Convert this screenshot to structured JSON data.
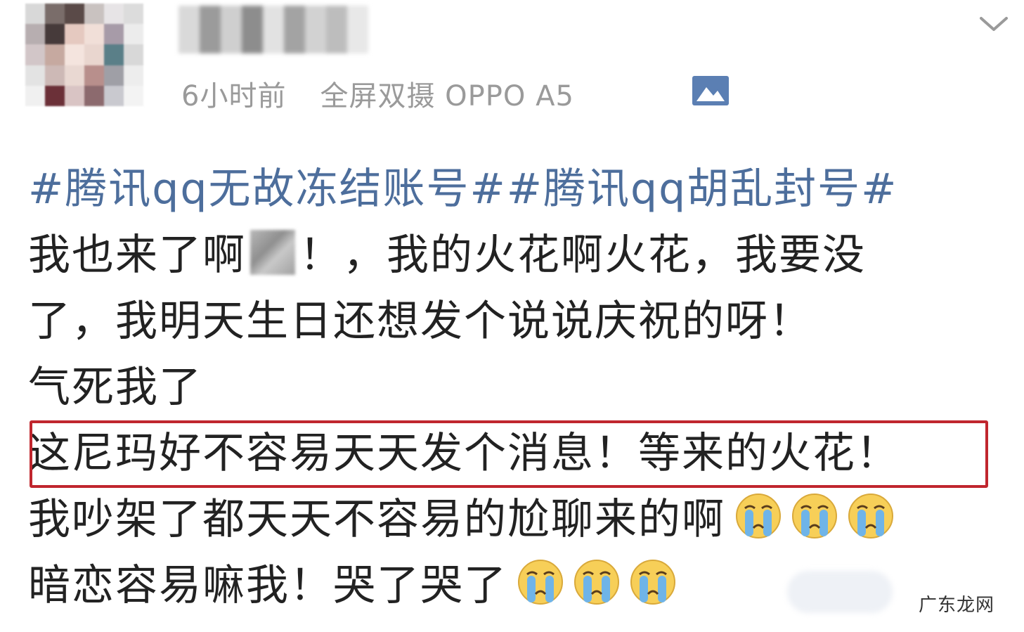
{
  "post": {
    "time": "6小时前",
    "device": "全屏双摄 OPPO A5",
    "hashtags": [
      "#腾讯qq无故冻结账号#",
      "#腾讯qq胡乱封号#"
    ],
    "lines": {
      "l2a": "我也来了啊",
      "l2b": "！，我的火花啊火花，我要没",
      "l3": "了，我明天生日还想发个说说庆祝的呀！",
      "l4": "气死我了",
      "l5": "这尼玛好不容易天天发个消息！等来的火花！",
      "l6": "我吵架了都天天不容易的尬聊来的啊",
      "l7": "暗恋容易嘛我！哭了哭了"
    }
  },
  "icons": {
    "photo": "image-icon",
    "expand": "chevron-down-icon",
    "emoji": "crying-face-emoji"
  },
  "colors": {
    "hashtag": "#4d6e9c",
    "highlight_border": "#c0262e",
    "meta_text": "#9a9a9a"
  },
  "watermark": "广东龙网"
}
